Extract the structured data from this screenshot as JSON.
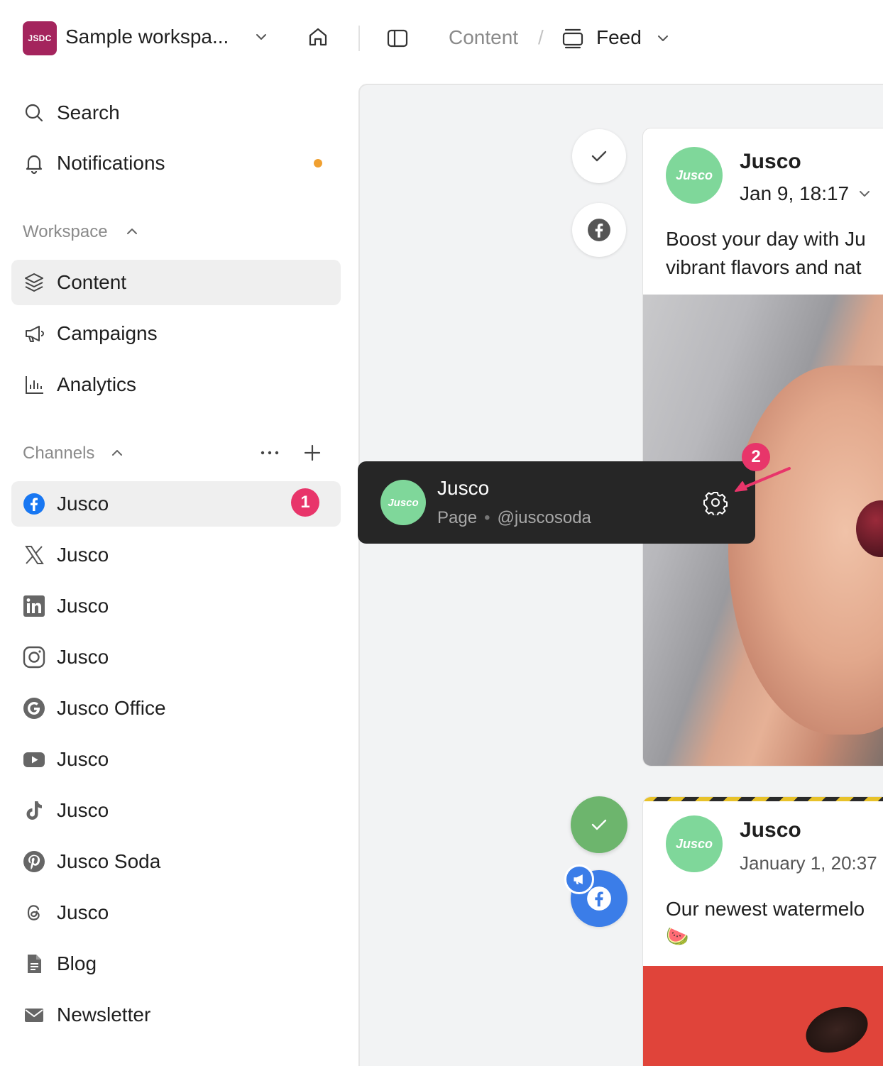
{
  "workspace": {
    "logo_text": "JSDC",
    "name": "Sample workspa..."
  },
  "breadcrumb": {
    "content": "Content",
    "separator": "/",
    "feed": "Feed"
  },
  "nav": {
    "search": "Search",
    "notifications": "Notifications",
    "workspace_section": "Workspace",
    "content": "Content",
    "campaigns": "Campaigns",
    "analytics": "Analytics",
    "channels_section": "Channels"
  },
  "channels": [
    {
      "label": "Jusco",
      "icon": "facebook-icon",
      "badge": "1"
    },
    {
      "label": "Jusco",
      "icon": "x-icon"
    },
    {
      "label": "Jusco",
      "icon": "linkedin-icon"
    },
    {
      "label": "Jusco",
      "icon": "instagram-icon"
    },
    {
      "label": "Jusco Office",
      "icon": "google-icon"
    },
    {
      "label": "Jusco",
      "icon": "youtube-icon"
    },
    {
      "label": "Jusco",
      "icon": "tiktok-icon"
    },
    {
      "label": "Jusco Soda",
      "icon": "pinterest-icon"
    },
    {
      "label": "Jusco",
      "icon": "threads-icon"
    },
    {
      "label": "Blog",
      "icon": "document-icon"
    },
    {
      "label": "Newsletter",
      "icon": "mail-icon"
    }
  ],
  "tooltip": {
    "name": "Jusco",
    "type": "Page",
    "handle": "@juscosoda",
    "step": "2"
  },
  "posts": [
    {
      "avatar_text": "Jusco",
      "name": "Jusco",
      "date": "Jan 9, 18:17",
      "text_line1": "Boost your day with Ju",
      "text_line2": "vibrant flavors and nat"
    },
    {
      "avatar_text": "Jusco",
      "name": "Jusco",
      "date": "January 1, 20:37",
      "text_line1": "Our newest watermelo",
      "text_line2": "🍉"
    }
  ],
  "colors": {
    "brand": "#a4245d",
    "badge": "#e8356a",
    "notif_dot": "#f0a030",
    "tooltip_bg": "#262626"
  }
}
